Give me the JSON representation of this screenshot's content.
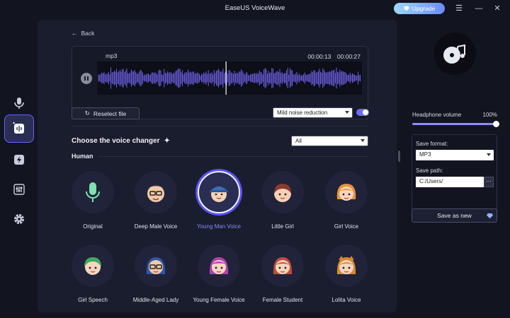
{
  "app": {
    "title": "EaseUS VoiceWave",
    "upgrade_label": "Upgrade"
  },
  "window_controls": [
    "menu-icon",
    "minimize-icon",
    "close-icon"
  ],
  "sidebar": {
    "items": [
      {
        "name": "microphone",
        "icon": "microphone-icon",
        "active": false
      },
      {
        "name": "voice-file",
        "icon": "audio-file-icon",
        "active": true
      },
      {
        "name": "effects",
        "icon": "lightning-icon",
        "active": false
      },
      {
        "name": "mixer",
        "icon": "sliders-icon",
        "active": false
      },
      {
        "name": "settings",
        "icon": "gear-icon",
        "active": false
      }
    ]
  },
  "main": {
    "back_label": "Back",
    "player": {
      "file_name": "mp3",
      "time": "00:00:13　00:00:27",
      "progress": 0.487
    },
    "reselect_label": "Reselect file",
    "noise": {
      "selected": "Mild noise reduction",
      "enabled": true
    },
    "section_title": "Choose the voice changer",
    "filter": {
      "selected": "All"
    },
    "group_label": "Human",
    "voices": [
      {
        "label": "Original",
        "avatar": "microphone-avatar",
        "active": false
      },
      {
        "label": "Deep Male Voice",
        "avatar": "man-glasses-avatar",
        "active": false
      },
      {
        "label": "Young Man Voice",
        "avatar": "young-man-cap-avatar",
        "active": true
      },
      {
        "label": "Little Girl",
        "avatar": "little-girl-avatar",
        "active": false
      },
      {
        "label": "Girl Voice",
        "avatar": "girl-avatar",
        "active": false
      },
      {
        "label": "Girl Speech",
        "avatar": "girl-green-hair-avatar",
        "active": false
      },
      {
        "label": "Middle-Aged Lady",
        "avatar": "lady-glasses-avatar",
        "active": false
      },
      {
        "label": "Young Female Voice",
        "avatar": "young-female-avatar",
        "active": false
      },
      {
        "label": "Female Student",
        "avatar": "female-student-avatar",
        "active": false
      },
      {
        "label": "Lolita Voice",
        "avatar": "lolita-avatar",
        "active": false
      }
    ]
  },
  "right": {
    "headphone_label": "Headphone volume",
    "headphone_value": "100%",
    "headphone_level": 1.0,
    "save_format_label": "Save format:",
    "save_format_value": "MP3",
    "save_path_label": "Save path:",
    "save_path_value": "C:/Users/",
    "browse_label": "···",
    "save_as_label": "Save as new"
  },
  "colors": {
    "accent": "#6b6cff",
    "active_voice_text": "#8a88ff",
    "background": "#121420",
    "panel": "#1a1d2e"
  }
}
